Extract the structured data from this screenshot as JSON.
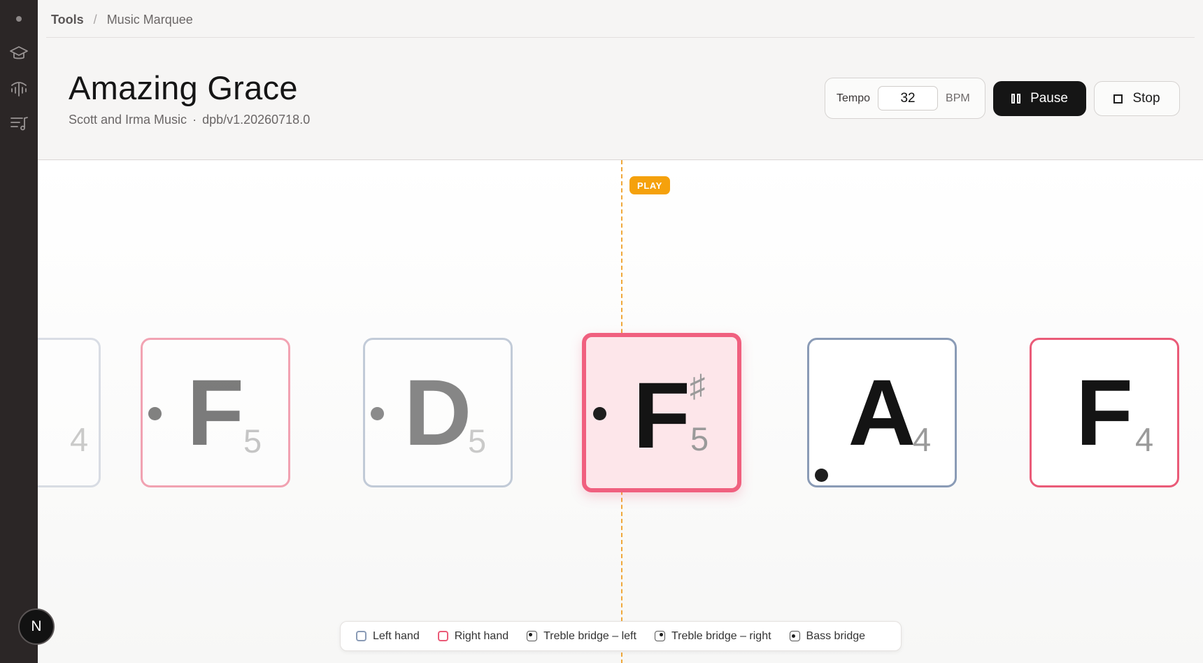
{
  "breadcrumb": {
    "root": "Tools",
    "separator": "/",
    "current": "Music Marquee"
  },
  "song": {
    "title": "Amazing Grace",
    "author": "Scott and Irma Music",
    "dot": "·",
    "version": "dpb/v1.20260718.0"
  },
  "controls": {
    "tempo_label": "Tempo",
    "tempo_value": "32",
    "tempo_unit": "BPM",
    "pause_label": "Pause",
    "stop_label": "Stop"
  },
  "playhead": {
    "label": "PLAY",
    "color": "#f5a10c"
  },
  "notes": [
    {
      "letter": "",
      "octave": "4",
      "accidental": "",
      "hand": "left",
      "state": "past"
    },
    {
      "letter": "F",
      "octave": "5",
      "accidental": "",
      "hand": "right",
      "bridge": "treble-left",
      "state": "past"
    },
    {
      "letter": "D",
      "octave": "5",
      "accidental": "",
      "hand": "left",
      "bridge": "treble-left",
      "state": "past"
    },
    {
      "letter": "F",
      "octave": "5",
      "accidental": "♯",
      "hand": "right",
      "bridge": "treble-left",
      "state": "active"
    },
    {
      "letter": "A",
      "octave": "4",
      "accidental": "",
      "hand": "left",
      "bridge": "bass",
      "state": "upcoming"
    },
    {
      "letter": "F",
      "octave": "4",
      "accidental": "",
      "hand": "right",
      "state": "upcoming"
    }
  ],
  "legend": {
    "left_hand": "Left hand",
    "right_hand": "Right hand",
    "treble_left": "Treble bridge – left",
    "treble_right": "Treble bridge – right",
    "bass": "Bass bridge"
  },
  "user": {
    "avatar_initial": "N"
  },
  "colors": {
    "left_hand": "#8a9bb6",
    "right_hand": "#ea5b78",
    "active_fill": "#fde6ea",
    "accent": "#f5a10c"
  }
}
